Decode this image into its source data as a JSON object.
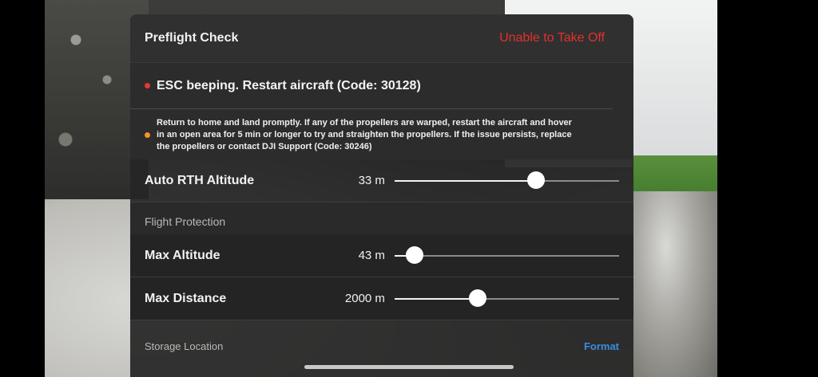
{
  "preflight": {
    "title": "Preflight Check",
    "status": "Unable to Take Off",
    "status_color": "#e2312d"
  },
  "warnings": [
    {
      "level": "error",
      "color": "#e23a33",
      "text": "ESC beeping. Restart aircraft (Code: 30128)"
    },
    {
      "level": "warning",
      "color": "#f0952f",
      "text": "Return to home and land promptly. If any of the propellers are warped, restart the aircraft and hover in an open area for 5 min or longer to try and straighten the propellers. If the issue persists, replace the propellers or contact DJI Support (Code: 30246)"
    }
  ],
  "auto_rth": {
    "label": "Auto RTH Altitude",
    "value": "33 m",
    "slider_fraction": 0.63
  },
  "flight_protection": {
    "heading": "Flight Protection",
    "max_altitude": {
      "label": "Max Altitude",
      "value": "43 m",
      "slider_fraction": 0.09
    },
    "max_distance": {
      "label": "Max Distance",
      "value": "2000 m",
      "slider_fraction": 0.37
    }
  },
  "storage": {
    "label": "Storage Location",
    "format_label": "Format",
    "accent": "#3a8de0"
  }
}
